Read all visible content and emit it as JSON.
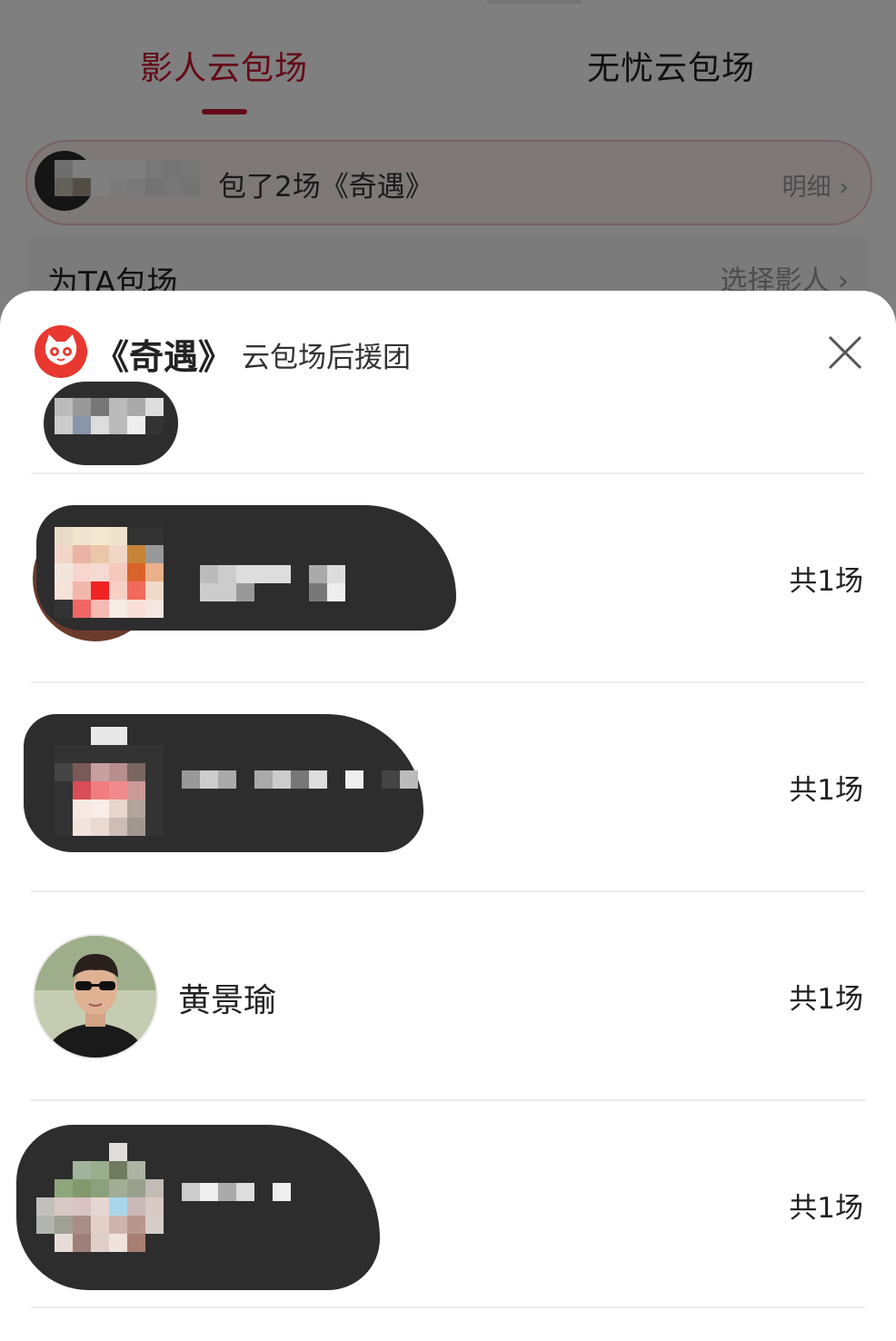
{
  "tabs": [
    {
      "label": "影人云包场",
      "active": true
    },
    {
      "label": "无忧云包场",
      "active": false
    }
  ],
  "banner": {
    "text": "包了2场《奇遇》",
    "link_label": "明细",
    "link_chevron": "›"
  },
  "sponsor_row": {
    "title": "为TA包场",
    "link_label": "选择影人",
    "link_chevron": "›"
  },
  "sheet": {
    "logo_icon": "maoyan-cat-logo-icon",
    "title": "《奇遇》",
    "subtitle": "云包场后援团",
    "close_icon": "close-icon",
    "members": [
      {
        "name": "",
        "count_label": "共1场",
        "redacted": true
      },
      {
        "name": "",
        "count_label": "共1场",
        "redacted": true
      },
      {
        "name": "黄景瑜",
        "count_label": "共1场",
        "redacted": false
      },
      {
        "name": "",
        "count_label": "共1场",
        "redacted": true
      }
    ]
  },
  "colors": {
    "accent": "#c9152e",
    "logo_red": "#e8382f",
    "overlay": "rgba(0,0,0,0.5)",
    "redaction": "#2d2d2d"
  }
}
